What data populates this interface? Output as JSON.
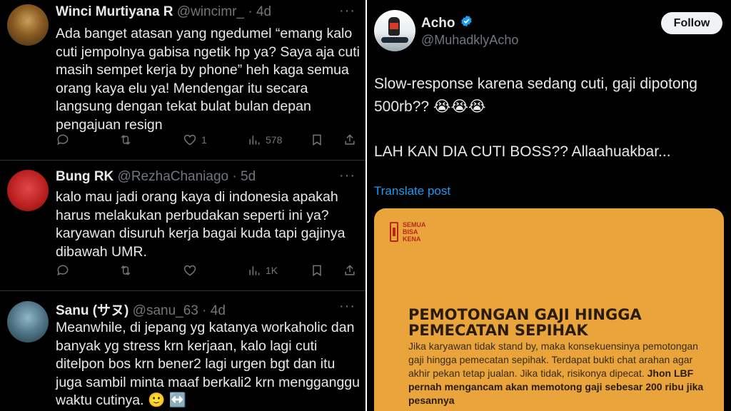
{
  "replies": [
    {
      "name": "Winci Murtiyana R",
      "handle": "@wincimr_",
      "dot": "·",
      "time": "4d",
      "more": "···",
      "text": "Ada banget atasan yang ngedumel “emang kalo cuti jempolnya gabisa ngetik hp ya? Saya aja cuti masih sempet kerja by phone” heh kaga semua orang kaya elu ya! Mendengar itu secara langsung dengan tekat bulat bulan depan pengajuan resign",
      "likes": "1",
      "views": "578"
    },
    {
      "name": "Bung RK",
      "handle": "@RezhaChaniago",
      "dot": "·",
      "time": "5d",
      "more": "···",
      "text": "kalo mau jadi orang kaya di indonesia apakah harus melakukan perbudakan seperti ini ya? karyawan disuruh kerja bagai kuda tapi gajinya dibawah UMR.",
      "likes": "",
      "views": "1K"
    },
    {
      "name": "Sanu (サヌ)",
      "handle": "@sanu_63",
      "dot": "·",
      "time": "4d",
      "more": "···",
      "text": "Meanwhile, di jepang yg katanya workaholic dan banyak yg stress krn kerjaan, kalo lagi cuti ditelpon bos krn bener2 lagi urgen bgt dan itu juga sambil minta maaf berkali2 krn mengganggu waktu cutinya. 🙂 ↔️"
    }
  ],
  "main_post": {
    "name": "Acho",
    "handle": "@MuhadklyAcho",
    "follow_label": "Follow",
    "line1": "Slow-response karena sedang cuti, gaji dipotong",
    "line2": "500rb?? 😭😭😭",
    "line3": "LAH KAN DIA CUTI BOSS??  Allaahuakbar...",
    "translate": "Translate post",
    "media": {
      "brand": "SEMUA BISA KENA",
      "title": "PEMOTONGAN GAJI HINGGA PEMECATAN SEPIHAK",
      "body": "Jika karyawan tidak stand by, maka konsekuensinya pemotongan gaji hingga pemecatan sepihak. Terdapat bukti chat arahan agar akhir pekan tetap jualan. Jika tidak, risikonya dipecat.",
      "body_bold": "Jhon LBF pernah mengancam akan memotong gaji sebesar 200 ribu jika pesannya"
    }
  },
  "colors": {
    "accent": "#1d9bf0",
    "muted": "#71767b",
    "media_bg": "#e9a53b"
  }
}
